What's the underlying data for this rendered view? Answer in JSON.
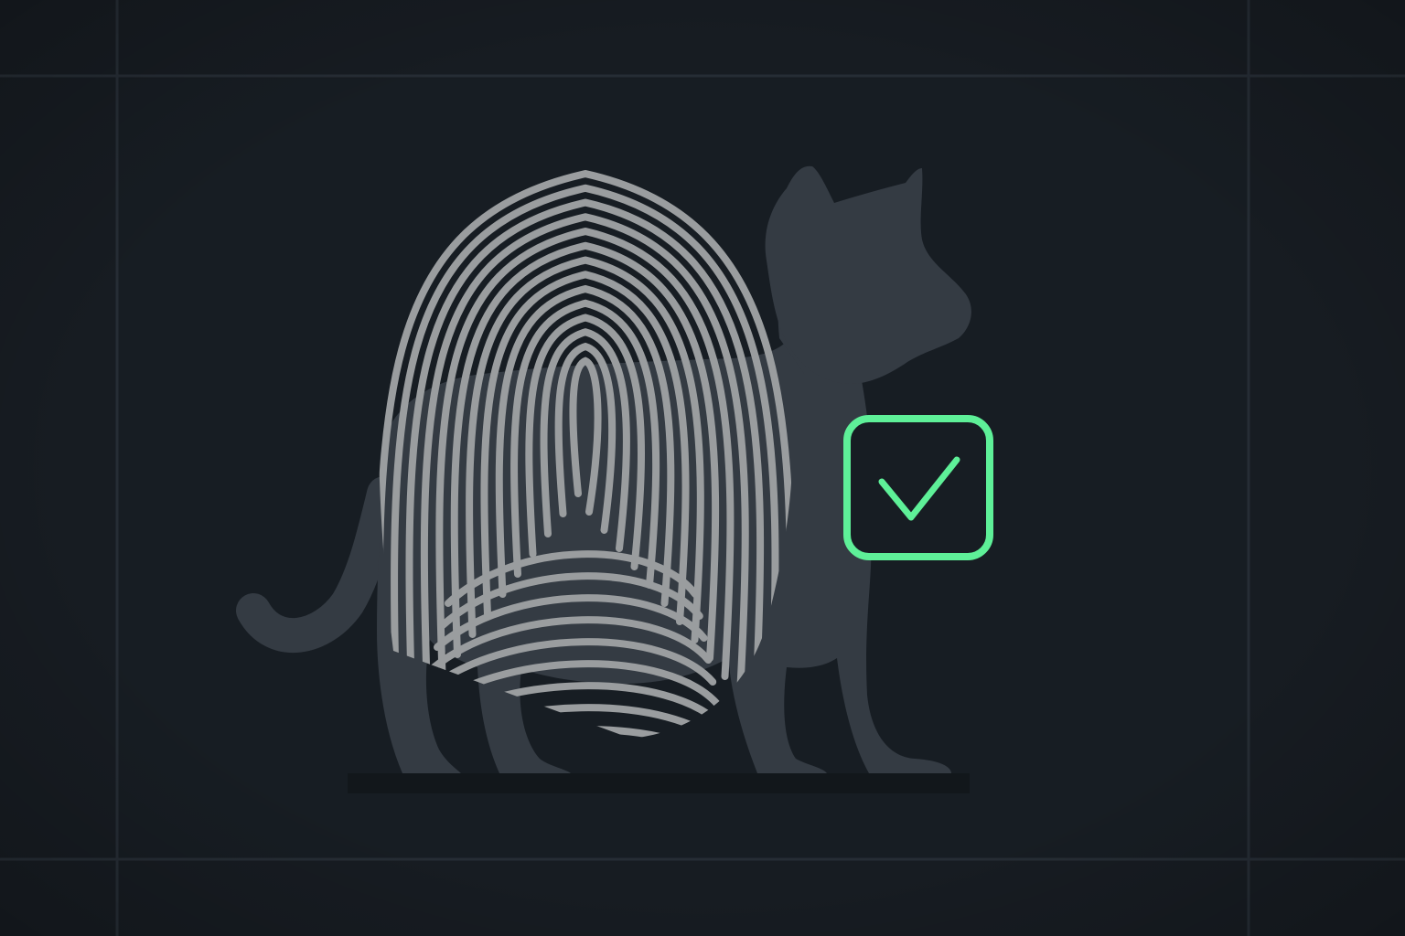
{
  "illustration": {
    "subject_icons": [
      "cat-silhouette-icon",
      "fingerprint-icon",
      "checkmark-icon"
    ]
  },
  "colors": {
    "background": "#171c22",
    "panel": "#171d23",
    "grid_line": "#262d35",
    "cat_silhouette": "#343b43",
    "fingerprint_ridges": "#9a9d9f",
    "check_accent": "#5ef098"
  }
}
